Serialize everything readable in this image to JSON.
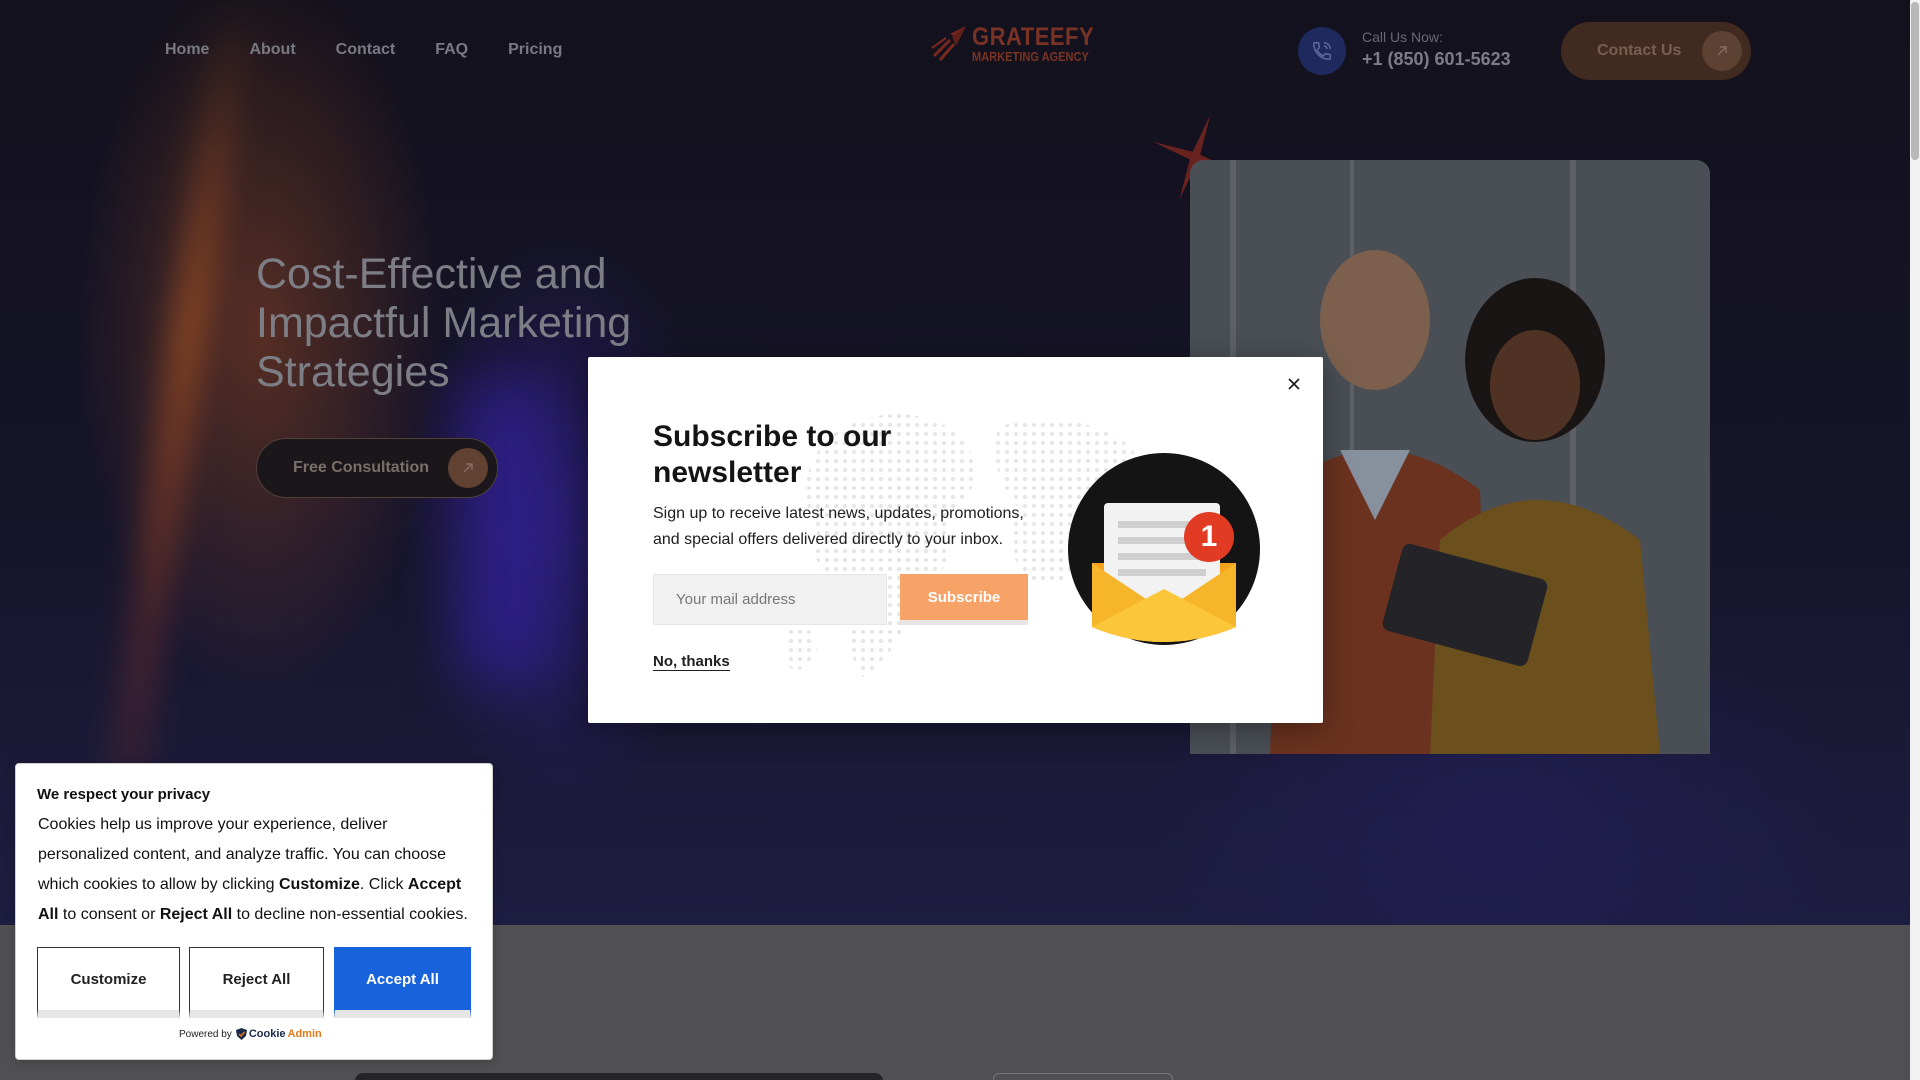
{
  "nav": {
    "items": [
      {
        "label": "Home"
      },
      {
        "label": "About"
      },
      {
        "label": "Contact"
      },
      {
        "label": "FAQ"
      },
      {
        "label": "Pricing"
      }
    ]
  },
  "logo": {
    "name": "GRATEEFY",
    "tagline": "MARKETING AGENCY"
  },
  "header": {
    "call_label": "Call Us Now:",
    "phone": "+1 (850) 601-5623",
    "contact_button": "Contact Us"
  },
  "hero": {
    "headline": "Cost-Effective and Impactful Marketing Strategies",
    "cta": "Free Consultation"
  },
  "newsletter": {
    "title": "Subscribe to our newsletter",
    "text": "Sign up to receive latest news, updates, promotions, and special offers delivered directly to your inbox.",
    "email_placeholder": "Your mail address",
    "subscribe_button": "Subscribe",
    "dismiss_link": "No, thanks",
    "badge_count": "1"
  },
  "cookie": {
    "title": "We respect your privacy",
    "text_1": "Cookies help us improve your experience, deliver personalized content, and analyze traffic. You can choose which cookies to allow by clicking ",
    "text_customize": "Customize",
    "text_2": ". Click ",
    "text_accept": "Accept All",
    "text_3": " to consent or ",
    "text_reject": "Reject All",
    "text_4": " to decline non-essential cookies.",
    "buttons": {
      "customize": "Customize",
      "reject": "Reject All",
      "accept": "Accept All"
    },
    "powered_by": "Powered by",
    "brand_a": "Cookie",
    "brand_b": "Admin"
  },
  "colors": {
    "accent_orange": "#f7a267",
    "accept_blue": "#1863dc",
    "brand_red": "#c0392b"
  }
}
